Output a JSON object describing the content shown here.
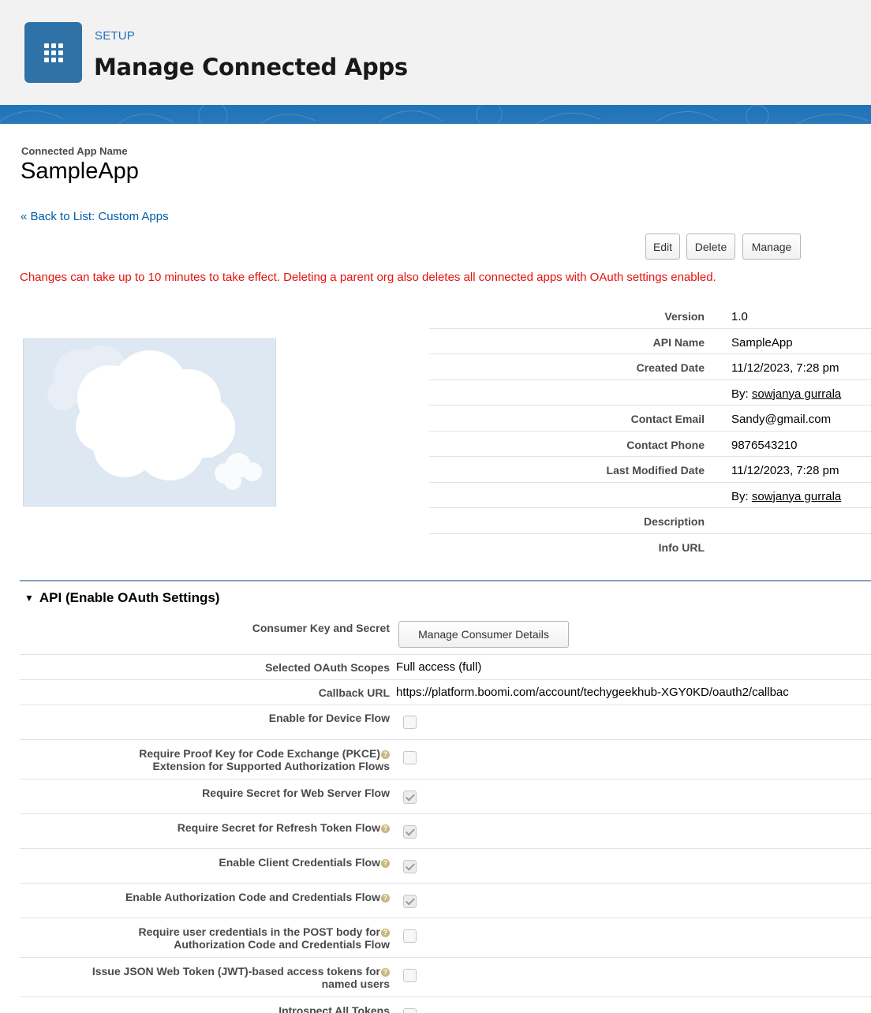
{
  "header": {
    "section_label": "SETUP",
    "title": "Manage Connected Apps"
  },
  "app": {
    "name_label": "Connected App Name",
    "name": "SampleApp",
    "back_link": "« Back to List: Custom Apps"
  },
  "actions": {
    "edit": "Edit",
    "delete": "Delete",
    "manage": "Manage"
  },
  "warning": "Changes can take up to 10 minutes to take effect. Deleting a parent org also deletes all connected apps with OAuth settings enabled.",
  "details": {
    "version_label": "Version",
    "version": "1.0",
    "api_name_label": "API Name",
    "api_name": "SampleApp",
    "created_date_label": "Created Date",
    "created_date": "11/12/2023, 7:28 pm",
    "created_by_prefix": "By:",
    "created_by": "sowjanya gurrala",
    "contact_email_label": "Contact Email",
    "contact_email": "Sandy@gmail.com",
    "contact_phone_label": "Contact Phone",
    "contact_phone": "9876543210",
    "last_modified_label": "Last Modified Date",
    "last_modified": "11/12/2023, 7:28 pm",
    "modified_by_prefix": "By:",
    "modified_by": "sowjanya gurrala",
    "description_label": "Description",
    "info_url_label": "Info URL"
  },
  "api_section": {
    "title": "API (Enable OAuth Settings)",
    "consumer_key_label": "Consumer Key and Secret",
    "consumer_button": "Manage Consumer Details",
    "scopes_label": "Selected OAuth Scopes",
    "scopes": "Full access (full)",
    "callback_label": "Callback URL",
    "callback": "https://platform.boomi.com/account/techygeekhub-XGY0KD/oauth2/callbac",
    "device_flow_label": "Enable for Device Flow",
    "pkce_label_1": "Require Proof Key for Code Exchange (PKCE)",
    "pkce_label_2": "Extension for Supported Authorization Flows",
    "secret_web_label": "Require Secret for Web Server Flow",
    "secret_refresh_label": "Require Secret for Refresh Token Flow",
    "client_creds_label": "Enable Client Credentials Flow",
    "auth_code_creds_label": "Enable Authorization Code and Credentials Flow",
    "user_creds_label_1": "Require user credentials in the POST body for",
    "user_creds_label_2": "Authorization Code and Credentials Flow",
    "jwt_label_1": "Issue JSON Web Token (JWT)-based access tokens for",
    "jwt_label_2": "named users",
    "introspect_label": "Introspect All Tokens",
    "help_glyph": "?"
  },
  "colors": {
    "brand_blue": "#2e72a8",
    "link": "#015ba7",
    "warning": "#e8110d",
    "header_bg": "#f3f2f2"
  },
  "icons": {
    "app_launcher": "waffle-grid-icon",
    "logo": "cloud-icon",
    "help": "help-icon"
  }
}
